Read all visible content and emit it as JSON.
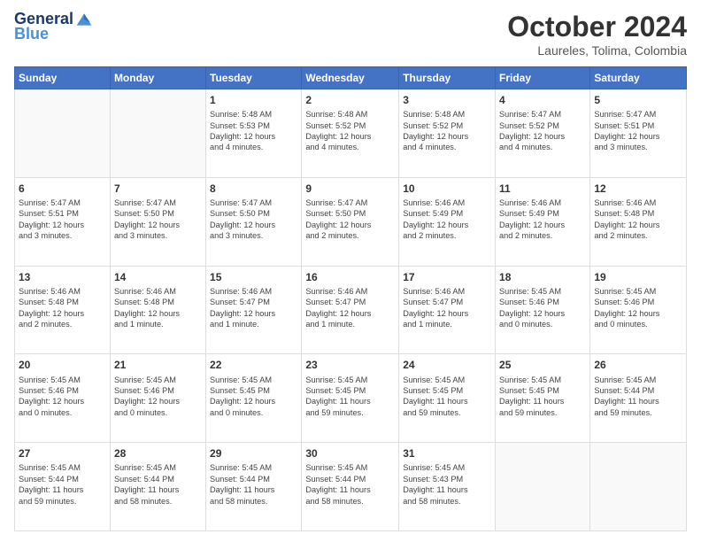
{
  "header": {
    "logo_line1": "General",
    "logo_line2": "Blue",
    "month": "October 2024",
    "location": "Laureles, Tolima, Colombia"
  },
  "weekdays": [
    "Sunday",
    "Monday",
    "Tuesday",
    "Wednesday",
    "Thursday",
    "Friday",
    "Saturday"
  ],
  "weeks": [
    [
      {
        "day": "",
        "info": ""
      },
      {
        "day": "",
        "info": ""
      },
      {
        "day": "1",
        "info": "Sunrise: 5:48 AM\nSunset: 5:53 PM\nDaylight: 12 hours\nand 4 minutes."
      },
      {
        "day": "2",
        "info": "Sunrise: 5:48 AM\nSunset: 5:52 PM\nDaylight: 12 hours\nand 4 minutes."
      },
      {
        "day": "3",
        "info": "Sunrise: 5:48 AM\nSunset: 5:52 PM\nDaylight: 12 hours\nand 4 minutes."
      },
      {
        "day": "4",
        "info": "Sunrise: 5:47 AM\nSunset: 5:52 PM\nDaylight: 12 hours\nand 4 minutes."
      },
      {
        "day": "5",
        "info": "Sunrise: 5:47 AM\nSunset: 5:51 PM\nDaylight: 12 hours\nand 3 minutes."
      }
    ],
    [
      {
        "day": "6",
        "info": "Sunrise: 5:47 AM\nSunset: 5:51 PM\nDaylight: 12 hours\nand 3 minutes."
      },
      {
        "day": "7",
        "info": "Sunrise: 5:47 AM\nSunset: 5:50 PM\nDaylight: 12 hours\nand 3 minutes."
      },
      {
        "day": "8",
        "info": "Sunrise: 5:47 AM\nSunset: 5:50 PM\nDaylight: 12 hours\nand 3 minutes."
      },
      {
        "day": "9",
        "info": "Sunrise: 5:47 AM\nSunset: 5:50 PM\nDaylight: 12 hours\nand 2 minutes."
      },
      {
        "day": "10",
        "info": "Sunrise: 5:46 AM\nSunset: 5:49 PM\nDaylight: 12 hours\nand 2 minutes."
      },
      {
        "day": "11",
        "info": "Sunrise: 5:46 AM\nSunset: 5:49 PM\nDaylight: 12 hours\nand 2 minutes."
      },
      {
        "day": "12",
        "info": "Sunrise: 5:46 AM\nSunset: 5:48 PM\nDaylight: 12 hours\nand 2 minutes."
      }
    ],
    [
      {
        "day": "13",
        "info": "Sunrise: 5:46 AM\nSunset: 5:48 PM\nDaylight: 12 hours\nand 2 minutes."
      },
      {
        "day": "14",
        "info": "Sunrise: 5:46 AM\nSunset: 5:48 PM\nDaylight: 12 hours\nand 1 minute."
      },
      {
        "day": "15",
        "info": "Sunrise: 5:46 AM\nSunset: 5:47 PM\nDaylight: 12 hours\nand 1 minute."
      },
      {
        "day": "16",
        "info": "Sunrise: 5:46 AM\nSunset: 5:47 PM\nDaylight: 12 hours\nand 1 minute."
      },
      {
        "day": "17",
        "info": "Sunrise: 5:46 AM\nSunset: 5:47 PM\nDaylight: 12 hours\nand 1 minute."
      },
      {
        "day": "18",
        "info": "Sunrise: 5:45 AM\nSunset: 5:46 PM\nDaylight: 12 hours\nand 0 minutes."
      },
      {
        "day": "19",
        "info": "Sunrise: 5:45 AM\nSunset: 5:46 PM\nDaylight: 12 hours\nand 0 minutes."
      }
    ],
    [
      {
        "day": "20",
        "info": "Sunrise: 5:45 AM\nSunset: 5:46 PM\nDaylight: 12 hours\nand 0 minutes."
      },
      {
        "day": "21",
        "info": "Sunrise: 5:45 AM\nSunset: 5:46 PM\nDaylight: 12 hours\nand 0 minutes."
      },
      {
        "day": "22",
        "info": "Sunrise: 5:45 AM\nSunset: 5:45 PM\nDaylight: 12 hours\nand 0 minutes."
      },
      {
        "day": "23",
        "info": "Sunrise: 5:45 AM\nSunset: 5:45 PM\nDaylight: 11 hours\nand 59 minutes."
      },
      {
        "day": "24",
        "info": "Sunrise: 5:45 AM\nSunset: 5:45 PM\nDaylight: 11 hours\nand 59 minutes."
      },
      {
        "day": "25",
        "info": "Sunrise: 5:45 AM\nSunset: 5:45 PM\nDaylight: 11 hours\nand 59 minutes."
      },
      {
        "day": "26",
        "info": "Sunrise: 5:45 AM\nSunset: 5:44 PM\nDaylight: 11 hours\nand 59 minutes."
      }
    ],
    [
      {
        "day": "27",
        "info": "Sunrise: 5:45 AM\nSunset: 5:44 PM\nDaylight: 11 hours\nand 59 minutes."
      },
      {
        "day": "28",
        "info": "Sunrise: 5:45 AM\nSunset: 5:44 PM\nDaylight: 11 hours\nand 58 minutes."
      },
      {
        "day": "29",
        "info": "Sunrise: 5:45 AM\nSunset: 5:44 PM\nDaylight: 11 hours\nand 58 minutes."
      },
      {
        "day": "30",
        "info": "Sunrise: 5:45 AM\nSunset: 5:44 PM\nDaylight: 11 hours\nand 58 minutes."
      },
      {
        "day": "31",
        "info": "Sunrise: 5:45 AM\nSunset: 5:43 PM\nDaylight: 11 hours\nand 58 minutes."
      },
      {
        "day": "",
        "info": ""
      },
      {
        "day": "",
        "info": ""
      }
    ]
  ]
}
